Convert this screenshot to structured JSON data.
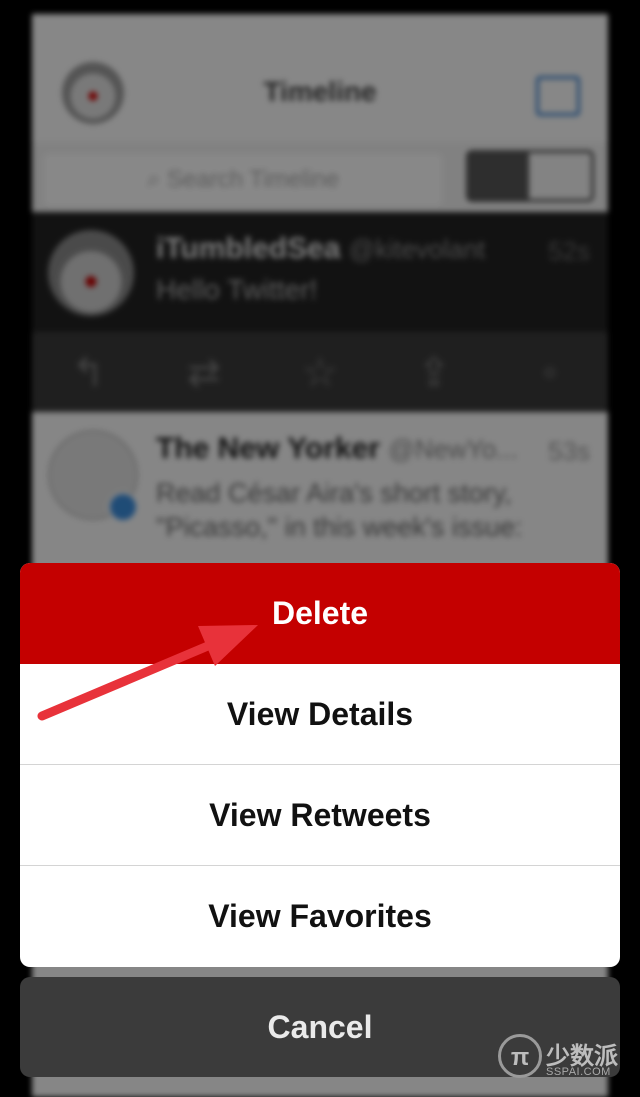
{
  "background": {
    "nav_title": "Timeline",
    "search_placeholder": "Search Timeline",
    "tweets": [
      {
        "name": "iTumbledSea",
        "handle": "@kitevolant",
        "time": "52s",
        "text": "Hello Twitter!"
      },
      {
        "name": "The New Yorker",
        "handle": "@NewYo...",
        "time": "53s",
        "text": "Read César Aira's short story, \"Picasso,\" in this week's issue:"
      }
    ]
  },
  "action_sheet": {
    "delete_label": "Delete",
    "view_details_label": "View Details",
    "view_retweets_label": "View Retweets",
    "view_favorites_label": "View Favorites",
    "cancel_label": "Cancel",
    "delete_color": "#c40000"
  },
  "annotation": {
    "arrow_color": "#e8323a"
  },
  "watermark": {
    "logo": "π",
    "cn": "少数派",
    "en": "SSPAI.COM"
  }
}
